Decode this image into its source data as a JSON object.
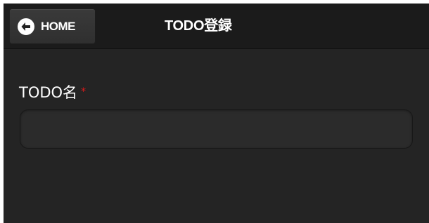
{
  "header": {
    "back_button": {
      "label": "HOME",
      "icon": "arrow-left-icon"
    },
    "title": "TODO登録"
  },
  "form": {
    "todo_name": {
      "label": "TODO名",
      "required_marker": "*",
      "value": "",
      "placeholder": ""
    }
  },
  "colors": {
    "background": "#242424",
    "header_background": "#1b1b1b",
    "button_background": "#353535",
    "input_background": "#2b2b2b",
    "text": "#ffffff",
    "required": "#e11b1b"
  }
}
